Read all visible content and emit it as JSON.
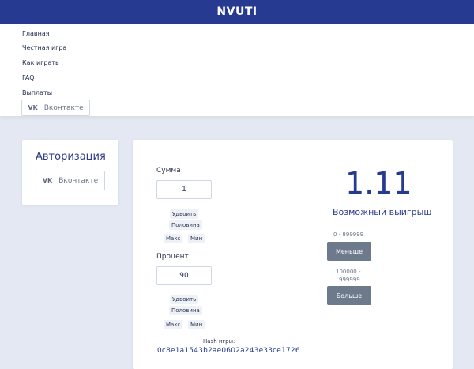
{
  "header": {
    "brand": "NVUTI"
  },
  "nav": {
    "items": [
      {
        "label": "Главная"
      },
      {
        "label": "Честная игра"
      },
      {
        "label": "Как играть"
      },
      {
        "label": "FAQ"
      },
      {
        "label": "Выплаты"
      }
    ],
    "vk_button": {
      "icon": "vk-icon",
      "label": "Вконтакте"
    }
  },
  "auth": {
    "title": "Авторизация",
    "vk_button": {
      "icon": "vk-icon",
      "label": "Вконтакте"
    }
  },
  "game": {
    "sum": {
      "label": "Сумма",
      "value": "1",
      "buttons": {
        "double": "Удвоить",
        "half": "Половина",
        "max": "Макс",
        "min": "Мин"
      }
    },
    "percent": {
      "label": "Процент",
      "value": "90",
      "buttons": {
        "double": "Удвоить",
        "half": "Половина",
        "max": "Макс",
        "min": "Мин"
      }
    },
    "multiplier": "1.11",
    "possible_win_label": "Возможный выигрыш",
    "less": {
      "range": "0 - 899999",
      "label": "Меньше"
    },
    "more": {
      "range_line1": "100000 -",
      "range_line2": "999999",
      "label": "Больше"
    },
    "hash": {
      "label": "Hash игры:",
      "value": "0c8e1a1543b2ae0602a243e33ce1726"
    }
  },
  "colors": {
    "primary": "#263a92",
    "background": "#e3e8f2",
    "button_dark": "#6c7a8c",
    "chip": "#eef1f6"
  }
}
